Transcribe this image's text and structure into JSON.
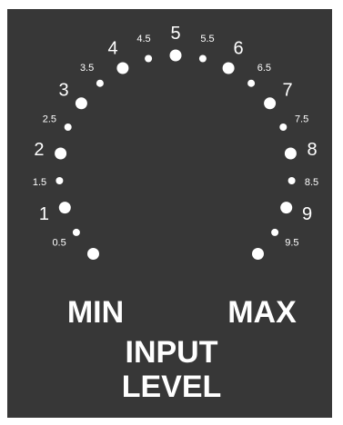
{
  "colors": {
    "panel": "#373737",
    "markings": "#ffffff",
    "background": "#ffffff"
  },
  "dial": {
    "marks": [
      {
        "value": "0",
        "label": "",
        "major": true
      },
      {
        "value": "0.5",
        "label": "0.5",
        "major": false
      },
      {
        "value": "1",
        "label": "1",
        "major": true
      },
      {
        "value": "1.5",
        "label": "1.5",
        "major": false
      },
      {
        "value": "2",
        "label": "2",
        "major": true
      },
      {
        "value": "2.5",
        "label": "2.5",
        "major": false
      },
      {
        "value": "3",
        "label": "3",
        "major": true
      },
      {
        "value": "3.5",
        "label": "3.5",
        "major": false
      },
      {
        "value": "4",
        "label": "4",
        "major": true
      },
      {
        "value": "4.5",
        "label": "4.5",
        "major": false
      },
      {
        "value": "5",
        "label": "5",
        "major": true
      },
      {
        "value": "5.5",
        "label": "5.5",
        "major": false
      },
      {
        "value": "6",
        "label": "6",
        "major": true
      },
      {
        "value": "6.5",
        "label": "6.5",
        "major": false
      },
      {
        "value": "7",
        "label": "7",
        "major": true
      },
      {
        "value": "7.5",
        "label": "7.5",
        "major": false
      },
      {
        "value": "8",
        "label": "8",
        "major": true
      },
      {
        "value": "8.5",
        "label": "8.5",
        "major": false
      },
      {
        "value": "9",
        "label": "9",
        "major": true
      },
      {
        "value": "9.5",
        "label": "9.5",
        "major": false
      },
      {
        "value": "10",
        "label": "",
        "major": true
      }
    ],
    "min_label": "MIN",
    "max_label": "MAX"
  },
  "title": {
    "line1": "INPUT",
    "line2": "LEVEL"
  }
}
